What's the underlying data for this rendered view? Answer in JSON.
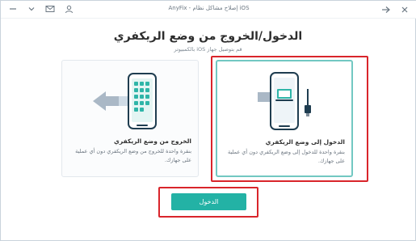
{
  "window": {
    "title": "AnyFix - إصلاح مشاكل نظام iOS"
  },
  "titlebar": {
    "icons": [
      "minimize-icon",
      "chevron-down-icon",
      "mail-icon",
      "user-icon",
      "close-icon",
      "back-arrow-icon"
    ]
  },
  "main": {
    "heading": "الدخول/الخروج من وضع الريكفري",
    "subheading": "قم بتوصيل جهاز iOS بالكمبيوتر"
  },
  "cards": {
    "enter": {
      "title": "الدخول إلى وضع الريكفري",
      "description": "بنقرة واحدة للدخول إلى وضع الريكفري دون أي عملية على جهازك."
    },
    "exit": {
      "title": "الخروج من وضع الريكفري",
      "description": "بنقرة واحدة للخروج من وضع الريكفري دون أي عملية على جهازك."
    }
  },
  "actions": {
    "enter_button": "الدخول"
  },
  "colors": {
    "accent": "#23b2a5",
    "selected_border": "#72c8c2",
    "annotation_red": "#d9252b"
  }
}
